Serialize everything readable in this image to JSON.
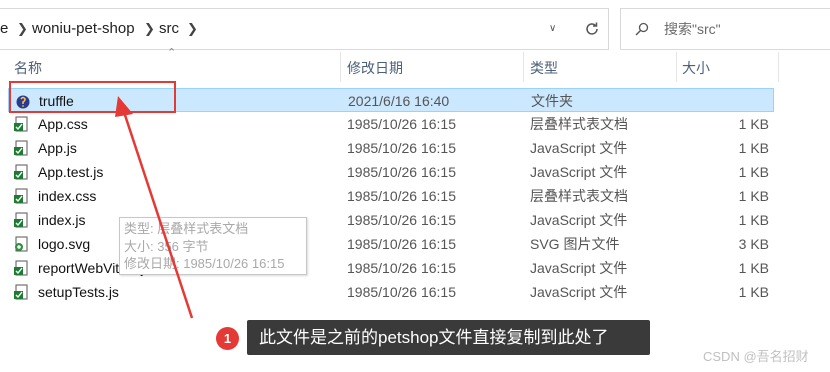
{
  "address_bar": {
    "crumbs": [
      "e",
      "woniu-pet-shop",
      "src"
    ]
  },
  "search": {
    "placeholder": "搜索\"src\""
  },
  "columns": {
    "name": "名称",
    "date": "修改日期",
    "type": "类型",
    "size": "大小"
  },
  "files": [
    {
      "name": "truffle",
      "date": "2021/6/16 16:40",
      "type": "文件夹",
      "size": "",
      "icon": "truffle-folder-icon",
      "selected": true
    },
    {
      "name": "App.css",
      "date": "1985/10/26 16:15",
      "type": "层叠样式表文档",
      "size": "1 KB",
      "icon": "css-file-icon"
    },
    {
      "name": "App.js",
      "date": "1985/10/26 16:15",
      "type": "JavaScript 文件",
      "size": "1 KB",
      "icon": "js-file-icon"
    },
    {
      "name": "App.test.js",
      "date": "1985/10/26 16:15",
      "type": "JavaScript 文件",
      "size": "1 KB",
      "icon": "js-file-icon"
    },
    {
      "name": "index.css",
      "date": "1985/10/26 16:15",
      "type": "层叠样式表文档",
      "size": "1 KB",
      "icon": "css-file-icon"
    },
    {
      "name": "index.js",
      "date": "1985/10/26 16:15",
      "type": "JavaScript 文件",
      "size": "1 KB",
      "icon": "js-file-icon"
    },
    {
      "name": "logo.svg",
      "date": "1985/10/26 16:15",
      "type": "SVG 图片文件",
      "size": "3 KB",
      "icon": "svg-file-icon"
    },
    {
      "name": "reportWebVitals.js",
      "date": "1985/10/26 16:15",
      "type": "JavaScript 文件",
      "size": "1 KB",
      "icon": "js-file-icon"
    },
    {
      "name": "setupTests.js",
      "date": "1985/10/26 16:15",
      "type": "JavaScript 文件",
      "size": "1 KB",
      "icon": "js-file-icon"
    }
  ],
  "tooltip": {
    "line1": "类型: 层叠样式表文档",
    "line2": "大小: 356 字节",
    "line3": "修改日期: 1985/10/26 16:15"
  },
  "annotation": {
    "badge": "1",
    "text": "此文件是之前的petshop文件直接复制到此处了",
    "color": "#e53935"
  },
  "watermark": "CSDN @吾名招财"
}
